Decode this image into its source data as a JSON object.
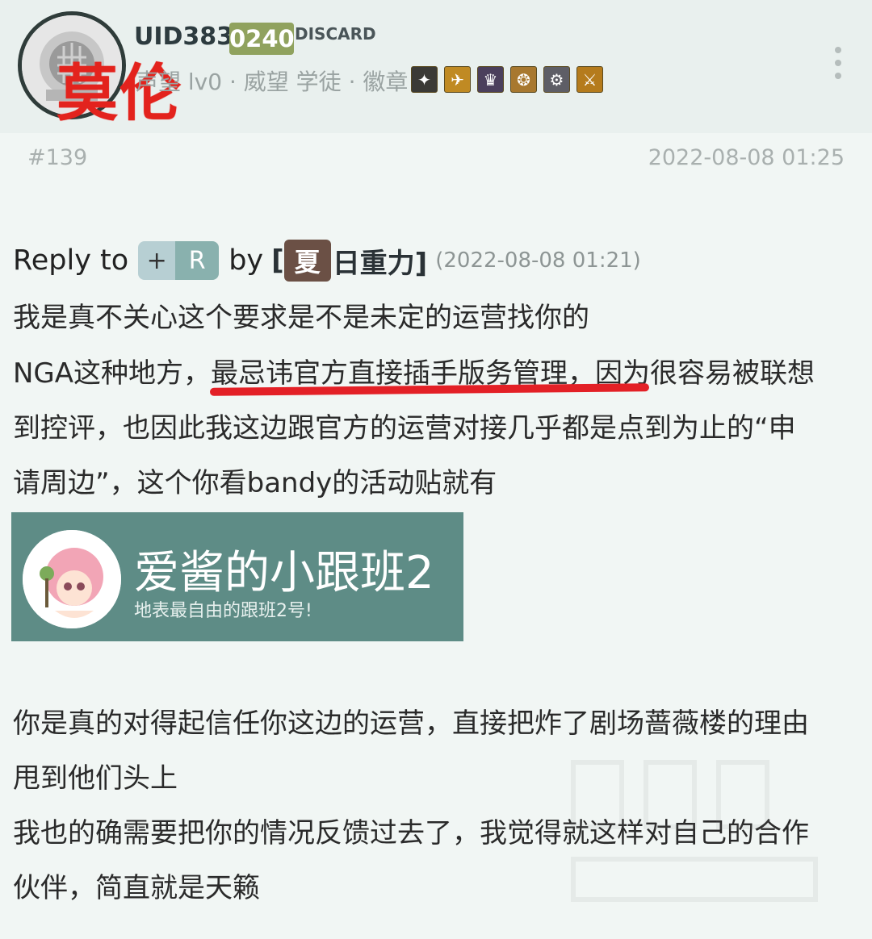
{
  "user": {
    "uid": "UID3833",
    "uid_suffix": "0240",
    "tag": "DISCARD",
    "watermark_name": "莫伦",
    "meta": "声望 lv0 · 威望 学徒 · 徽章",
    "badge_icons": [
      "badge-icon-1",
      "badge-icon-2",
      "badge-icon-3",
      "badge-icon-4",
      "badge-icon-5",
      "badge-icon-6"
    ]
  },
  "post": {
    "floor": "#139",
    "time": "2022-08-08 01:25"
  },
  "reply": {
    "prefix": "Reply to",
    "pill_plus": "+",
    "pill_r": "R",
    "by": "by",
    "author_open": "[",
    "author_box": "夏",
    "author_rest": "日重力]",
    "time": "(2022-08-08 01:21)"
  },
  "body": {
    "line1": "我是真不关心这个要求是不是未定的运营找你的",
    "line2": "NGA这种地方，最忌讳官方直接插手版务管理，因为很容易被联想",
    "line3": "到控评，也因此我这边跟官方的运营对接几乎都是点到为止的“申",
    "line4": "请周边”，这个你看bandy的活动贴就有",
    "line5": "你是真的对得起信任你这边的运营，直接把炸了剧场蔷薇楼的理由",
    "line6": "甩到他们头上",
    "line7": "我也的确需要把你的情况反馈过去了，我觉得就这样对自己的合作",
    "line8": "伙伴，简直就是天籁"
  },
  "banner": {
    "title": "爱酱的小跟班2",
    "subtitle": "地表最自由的跟班2号!"
  }
}
